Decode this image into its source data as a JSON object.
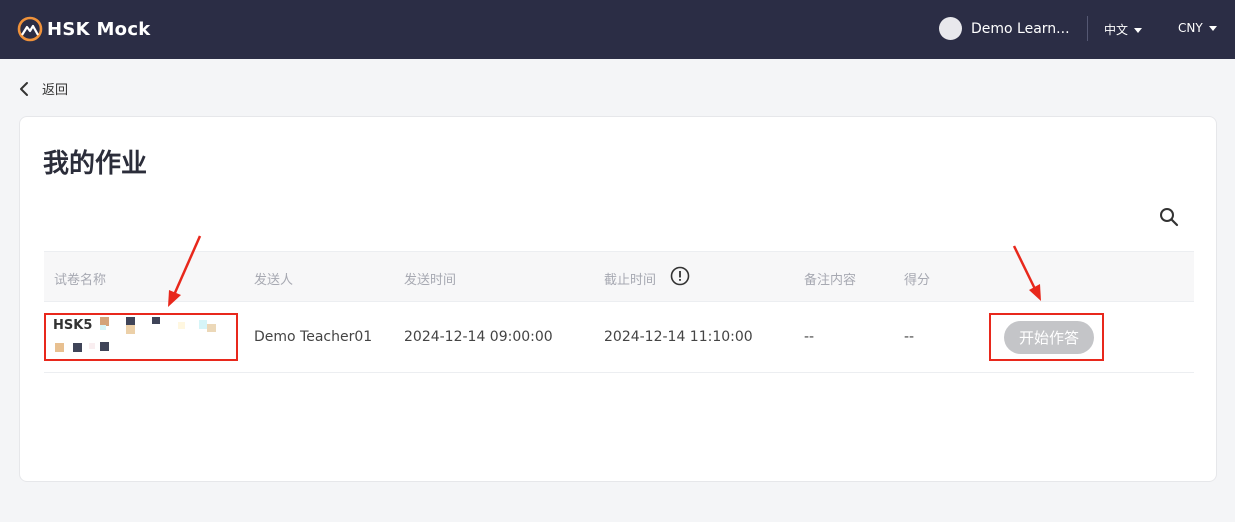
{
  "app": {
    "brand": "HSK Mock",
    "user_name": "Demo Learn...",
    "language": "中文",
    "currency": "CNY"
  },
  "nav": {
    "back_label": "返回"
  },
  "page": {
    "title": "我的作业",
    "table": {
      "headers": [
        "试卷名称",
        "发送人",
        "发送时间",
        "截止时间",
        "备注内容",
        "得分"
      ],
      "rows": [
        {
          "exam": "HSK5",
          "sender": "Demo Teacher01",
          "sent_time": "2024-12-14 09:00:00",
          "deadline": "2024-12-14 11:10:00",
          "note": "--",
          "score": "--",
          "action": "开始作答"
        }
      ]
    }
  },
  "colors": {
    "topbar": "#2b2d45",
    "brand_accent": "#f0923a",
    "highlight": "#e8281c",
    "button_disabled": "#c4c5c8"
  },
  "icons": [
    "logo-icon",
    "chevron-down-icon",
    "back-chevron-icon",
    "search-icon",
    "info-icon",
    "arrow-annotation-icon"
  ]
}
